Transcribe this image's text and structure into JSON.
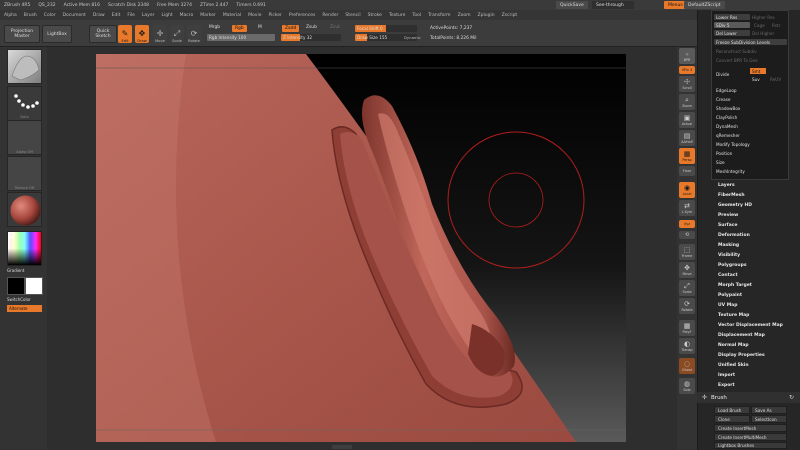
{
  "titlebar": {
    "app": "ZBrush 4R5",
    "project": "QS_232",
    "items": [
      "Active Mem 816",
      "Scratch Disk 2348",
      "Free Mem 3274",
      "ZTime 2.447",
      "Timers 0.691"
    ],
    "quicksave": "QuickSave",
    "see_through": "See-through",
    "menus": "Menus",
    "default_script": "DefaultZScript"
  },
  "menubar": [
    "Alpha",
    "Brush",
    "Color",
    "Document",
    "Draw",
    "Edit",
    "File",
    "Layer",
    "Light",
    "Macro",
    "Marker",
    "Material",
    "Movie",
    "Picker",
    "Preferences",
    "Render",
    "Stencil",
    "Stroke",
    "Texture",
    "Tool",
    "Transform",
    "Zoom",
    "Zplugin",
    "Zscript"
  ],
  "shelf": {
    "projection_master": "Projection Master",
    "lightbox": "LightBox",
    "quick_sketch": "Quick Sketch",
    "tools": [
      "Edit",
      "Draw",
      "Move",
      "Scale",
      "Rotate"
    ],
    "mrgb": "Mrgb",
    "rgb": "Rgb",
    "m": "M",
    "rgb_intensity": "Rgb Intensity 100",
    "zadd": "Zadd",
    "zsub": "Zsub",
    "zcut": "Zcut",
    "z_intensity": "Z Intensity 32",
    "focal_shift": "Focal Shift 0",
    "draw_size": "Draw Size 155",
    "dynamic": "Dynamic",
    "active_points": "ActivePoints: 7,237",
    "total_points": "TotalPoints: 8.226 Mil"
  },
  "lefttray": {
    "gradient": "Gradient",
    "switch_color": "SwitchColor",
    "alternate": "Alternate",
    "thumb_captions": [
      "",
      "Dots",
      "Alpha Off",
      "Texture Off",
      ""
    ]
  },
  "rightcol": [
    {
      "icon": "bpr-icon",
      "label": "BPR"
    },
    {
      "icon": "spix-icon",
      "label": "SPix 3"
    },
    {
      "icon": "scroll-icon",
      "label": "Scroll"
    },
    {
      "icon": "zoom-icon",
      "label": "Zoom"
    },
    {
      "icon": "actual-icon",
      "label": "Actual"
    },
    {
      "icon": "aahalf-icon",
      "label": "AAHalf"
    },
    {
      "icon": "persp-icon",
      "label": "Persp"
    },
    {
      "icon": "floor-icon",
      "label": "Floor"
    },
    {
      "icon": "local-icon",
      "label": "Local"
    },
    {
      "icon": "lsym-icon",
      "label": "L.Sym"
    },
    {
      "icon": "xyz-icon",
      "label": "Xyz"
    },
    {
      "icon": "rotate-icon",
      "label": ""
    },
    {
      "icon": "frame-icon",
      "label": "Frame"
    },
    {
      "icon": "move-icon",
      "label": "Move"
    },
    {
      "icon": "scale-icon",
      "label": "Scale"
    },
    {
      "icon": "rotate-view-icon",
      "label": "Rotate"
    },
    {
      "icon": "polyf-icon",
      "label": "PolyF"
    },
    {
      "icon": "transp-icon",
      "label": "Transp"
    },
    {
      "icon": "ghost-icon",
      "label": "Ghost"
    },
    {
      "icon": "solo-icon",
      "label": "Solo"
    }
  ],
  "dropdown": {
    "lower_res": "Lower Res",
    "higher_res": "Higher Res",
    "sdiv": "SDiv 5",
    "cage": "Cage",
    "rstr": "Rstr",
    "del_lower": "Del Lower",
    "del_higher": "Del Higher",
    "freeze": "Freeze SubDivision Levels",
    "reconstruct": "Reconstruct Subdiv",
    "convert_bpr": "Convert BPR To Geo",
    "divide": "Divide",
    "smt": "Smt",
    "suv": "Suv",
    "reuv": "ReUV",
    "items": [
      "EdgeLoop",
      "Crease",
      "ShadowBox",
      "ClayPolish",
      "DynaMesh",
      "qRemesher",
      "Modify Topology",
      "Position",
      "Size",
      "MeshIntegrity"
    ]
  },
  "palette": {
    "items": [
      "Layers",
      "FiberMesh",
      "Geometry HD",
      "Preview",
      "Surface",
      "Deformation",
      "Masking",
      "Visibility",
      "Polygroups",
      "Contact",
      "Morph Target",
      "Polypaint",
      "UV Map",
      "Texture Map",
      "Vector Displacement Map",
      "Displacement Map",
      "Normal Map",
      "Display Properties",
      "Unified Skin",
      "Import",
      "Export"
    ],
    "brush_title": "Brush",
    "load_brush": "Load Brush",
    "save_as": "Save As",
    "clone": "Clone",
    "selection": "SelectIcon",
    "create_insert_mesh": "Create InsertMesh",
    "create_insert_multi": "Create InsertMultiMesh",
    "lightbox_brushes": "Lightbox Brushes"
  },
  "colors": {
    "accent": "#e8792a",
    "skin": "#b25a50",
    "background": "#2a2a2a"
  }
}
